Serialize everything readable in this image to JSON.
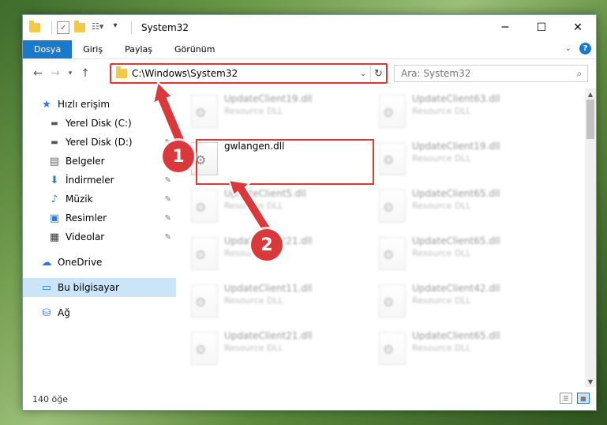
{
  "window": {
    "title": "System32"
  },
  "ribbon": {
    "tabs": [
      {
        "label": "Dosya",
        "active": true
      },
      {
        "label": "Giriş"
      },
      {
        "label": "Paylaş"
      },
      {
        "label": "Görünüm"
      }
    ],
    "help": "?"
  },
  "nav": {
    "address": "C:\\Windows\\System32",
    "search_placeholder": "Ara: System32"
  },
  "sidebar": {
    "items": [
      {
        "label": "Hızlı erişim"
      },
      {
        "label": "Yerel Disk (C:)"
      },
      {
        "label": "Yerel Disk (D:)"
      },
      {
        "label": "Belgeler"
      },
      {
        "label": "İndirmeler"
      },
      {
        "label": "Müzik"
      },
      {
        "label": "Resimler"
      },
      {
        "label": "Videolar"
      },
      {
        "label": "OneDrive"
      },
      {
        "label": "Bu bilgisayar"
      },
      {
        "label": "Ağ"
      }
    ]
  },
  "files": {
    "col1": [
      {
        "name": "UpdateClient19.dll",
        "desc": "Resource DLL"
      },
      {
        "name": "gwlangen.dll",
        "desc": ""
      },
      {
        "name": "UpdateClient5.dll",
        "desc": "Resource DLL"
      },
      {
        "name": "UpdateClient21.dll",
        "desc": "Resource DLL"
      },
      {
        "name": "UpdateClient11.dll",
        "desc": "Resource DLL"
      },
      {
        "name": "UpdateClient21.dll",
        "desc": "Resource DLL"
      }
    ],
    "col2": [
      {
        "name": "UpdateClient63.dll",
        "desc": "Resource DLL"
      },
      {
        "name": "UpdateClient19.dll",
        "desc": "Resource DLL"
      },
      {
        "name": "UpdateClient65.dll",
        "desc": "Resource DLL"
      },
      {
        "name": "UpdateClient65.dll",
        "desc": "Resource DLL"
      },
      {
        "name": "UpdateClient42.dll",
        "desc": "Resource DLL"
      },
      {
        "name": "UpdateClient65.dll",
        "desc": "Resource DLL"
      }
    ]
  },
  "status": {
    "count": "140 öğe"
  },
  "callouts": {
    "one": "1",
    "two": "2"
  },
  "colors": {
    "accent": "#1979ca",
    "highlight": "#d9393b"
  }
}
